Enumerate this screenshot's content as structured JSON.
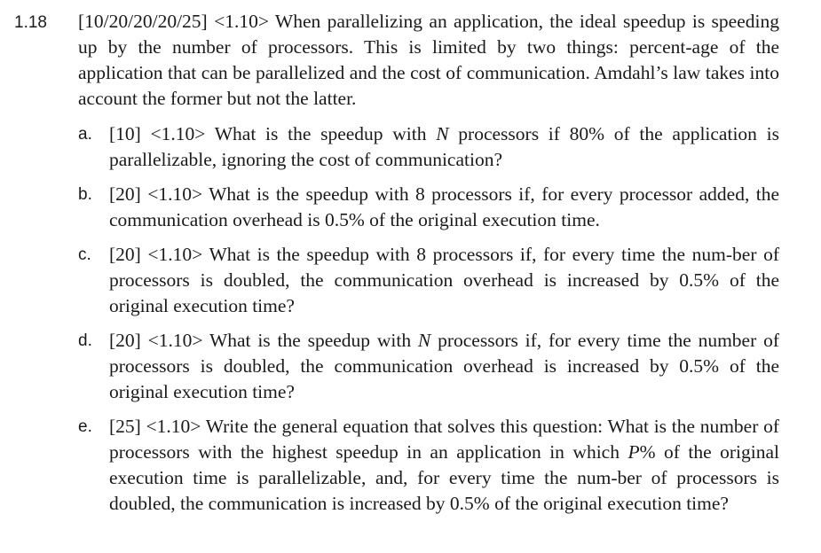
{
  "exercise": {
    "number": "1.18",
    "intro": "[10/20/20/20/25] <1.10> When parallelizing an application, the ideal speedup is speeding up by the number of processors. This is limited by two things: percent-age of the application that can be parallelized and the cost of communication. Amdahl’s law takes into account the former but not the latter."
  },
  "subs": {
    "a": {
      "letter": "a.",
      "pre": "[10] <1.10> What is the speedup with ",
      "var": "N",
      "post": " processors if 80% of the application is parallelizable, ignoring the cost of communication?"
    },
    "b": {
      "letter": "b.",
      "text": "[20] <1.10> What is the speedup with 8 processors if, for every processor added, the communication overhead is 0.5% of the original execution time."
    },
    "c": {
      "letter": "c.",
      "text": "[20] <1.10> What is the speedup with 8 processors if, for every time the num-ber of processors is doubled, the communication overhead is increased by 0.5% of the original execution time?"
    },
    "d": {
      "letter": "d.",
      "pre": "[20] <1.10> What is the speedup with ",
      "var": "N",
      "post": " processors if, for every time the number of processors is doubled, the communication overhead is increased by 0.5% of the original execution time?"
    },
    "e": {
      "letter": "e.",
      "pre": "[25] <1.10> Write the general equation that solves this question: What is the number of processors with the highest speedup in an application in which ",
      "var": "P",
      "post": "% of the original execution time is parallelizable, and, for every time the num-ber of processors is doubled, the communication is increased by 0.5% of the original execution time?"
    }
  }
}
